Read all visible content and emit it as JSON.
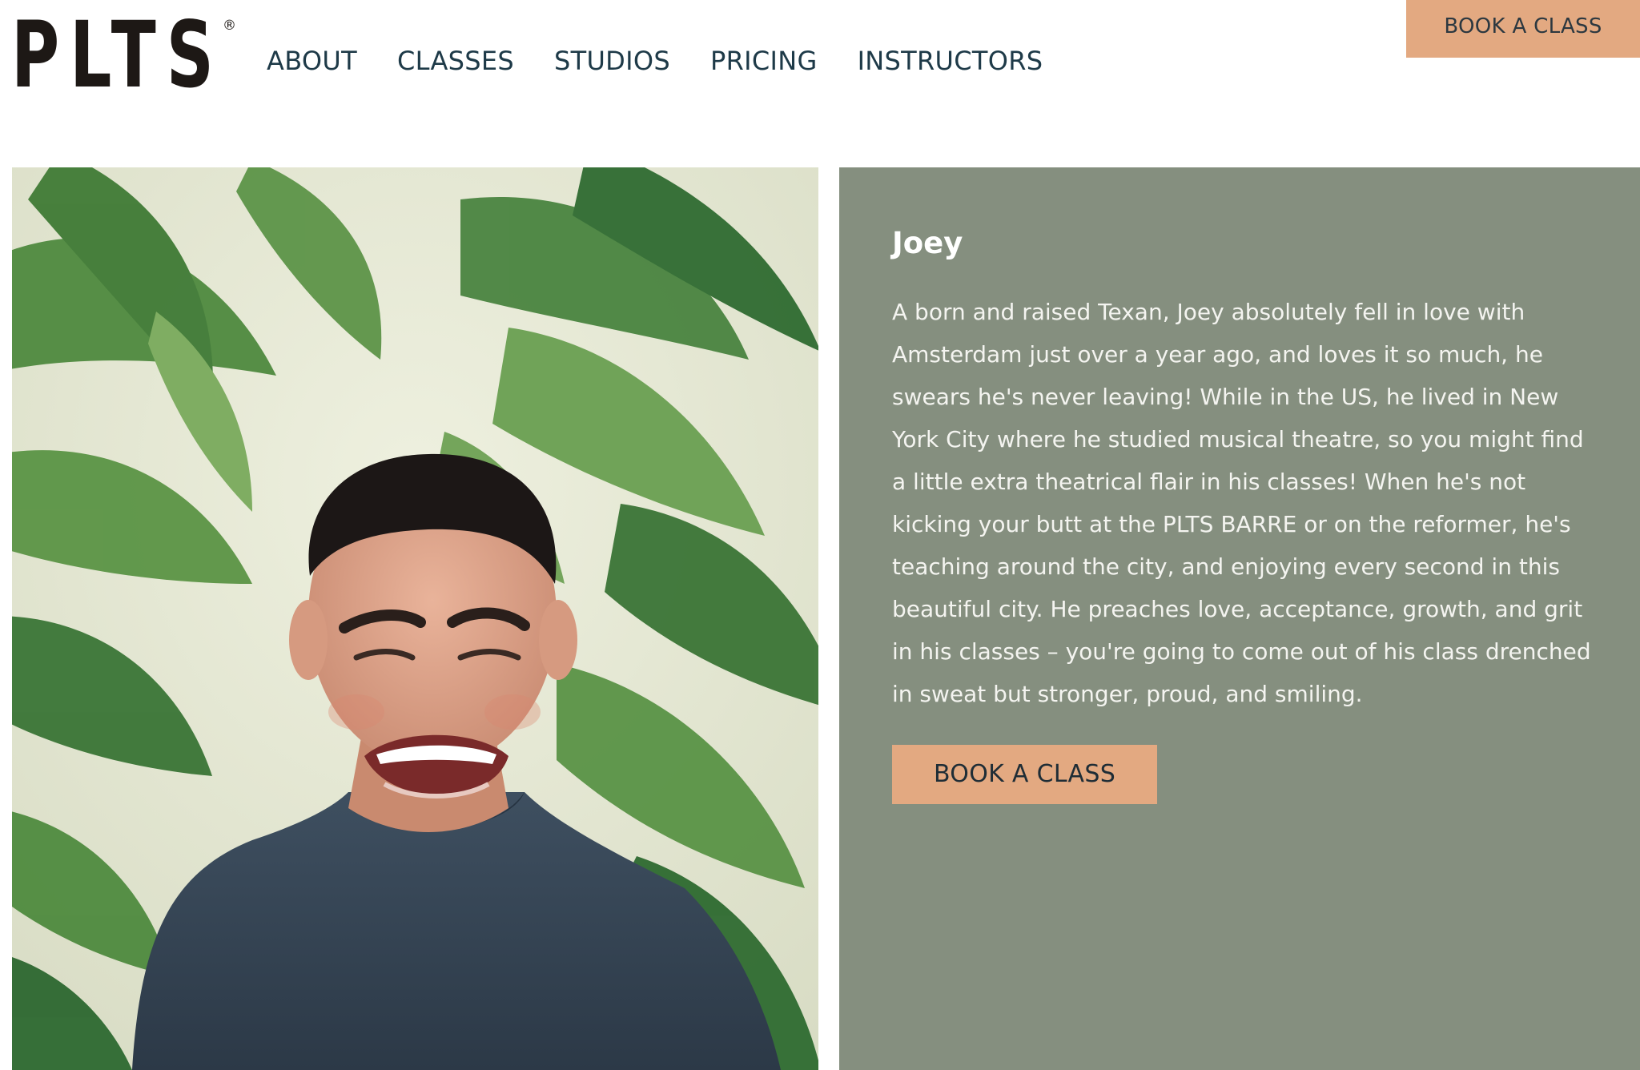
{
  "brand": {
    "logo_text": "PLTS",
    "registered_mark": "®"
  },
  "nav": {
    "items": [
      {
        "label": "ABOUT"
      },
      {
        "label": "CLASSES"
      },
      {
        "label": "STUDIOS"
      },
      {
        "label": "PRICING"
      },
      {
        "label": "INSTRUCTORS"
      }
    ],
    "cta_label": "BOOK A CLASS"
  },
  "instructor": {
    "name": "Joey",
    "bio": "A born and raised Texan, Joey absolutely fell in love with Amsterdam just over a year ago, and loves it so much, he swears he's never leaving! While in the US, he lived in New York City where he studied musical theatre, so you might find a little extra theatrical flair in his classes! When he's not kicking your butt at the PLTS BARRE or on the reformer, he's teaching around the city, and enjoying every second in this beautiful city. He preaches love, acceptance, growth, and grit in his classes – you're going to come out of his class drenched in sweat but stronger, proud, and smiling.",
    "cta_label": "BOOK A CLASS"
  },
  "colors": {
    "accent": "#e3a981",
    "panel": "#858f7f",
    "nav_text": "#1e3a48",
    "logo": "#1d1815"
  }
}
